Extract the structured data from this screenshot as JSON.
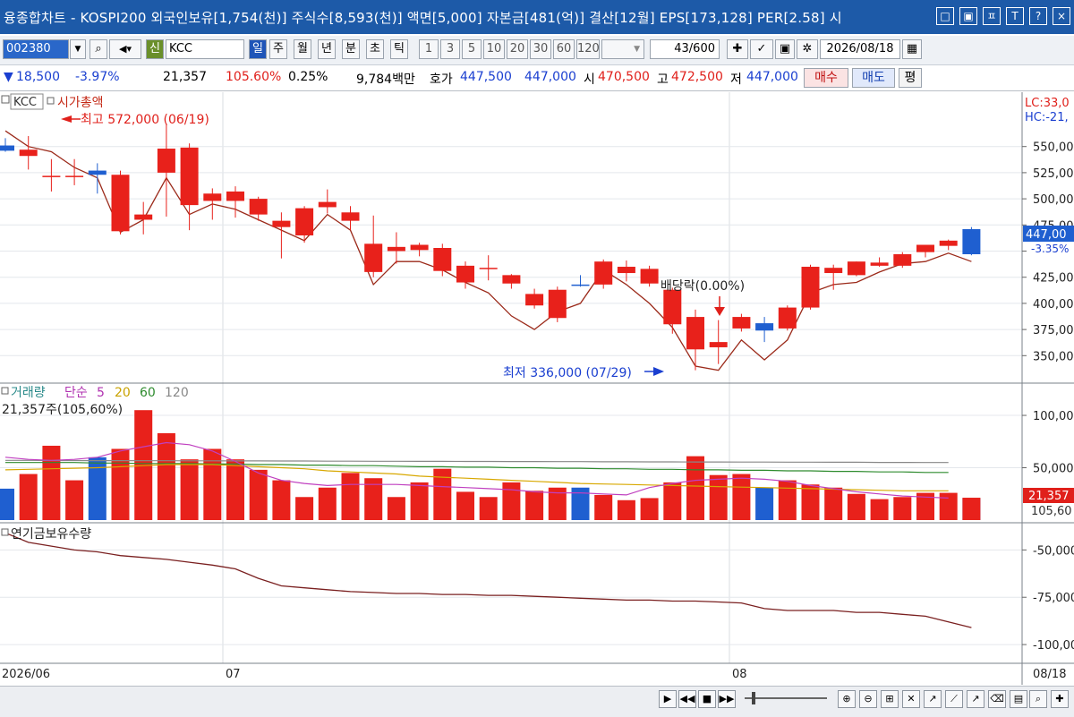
{
  "title": "융종합차트 - KOSPI200 외국인보유[1,754(천)] 주식수[8,593(천)] 액면[5,000] 자본금[481(억)] 결산[12월] EPS[173,128] PER[2.58] 시",
  "window_buttons": [
    "□",
    "▣",
    "ㅍ",
    "T",
    "?",
    "×"
  ],
  "toolbar": {
    "code": "002380",
    "new_label": "신",
    "name": "KCC",
    "periods": [
      "일",
      "주",
      "월",
      "년",
      "분",
      "초",
      "틱"
    ],
    "selected_period": "일",
    "minute_units": [
      "1",
      "3",
      "5",
      "10",
      "20",
      "30",
      "60",
      "120"
    ],
    "count": "43/600",
    "date": "2026/08/18"
  },
  "quote": {
    "change": "18,500",
    "change_pct": "-3.97%",
    "volume": "21,357",
    "volume_ratio": "105.60%",
    "turnover": "0.25%",
    "amount": "9,784백만",
    "bid_label": "호가",
    "ask": "447,500",
    "bid": "447,000",
    "open_label": "시",
    "open": "470,500",
    "high_label": "고",
    "high": "472,500",
    "low_label": "저",
    "low": "447,000",
    "buy": "매수",
    "sell": "매도",
    "eval": "평"
  },
  "colors": {
    "up": "#e8211b",
    "down": "#1f5fd0",
    "price_line": "#9b2a1a",
    "ma5": "#c040c0",
    "ma20": "#d8a800",
    "ma60": "#2e8b2e",
    "ma120": "#888888",
    "foreign_line": "#7a2020",
    "title_bg": "#1d5aa8"
  },
  "chart_data": [
    {
      "type": "candlestick",
      "legend_ticker": "KCC",
      "legend_series": "시가총액",
      "x_period_labels": [
        "2026/06",
        "07",
        "08",
        "08/18"
      ],
      "y_ticks": [
        350000,
        375000,
        400000,
        425000,
        450000,
        475000,
        500000,
        525000,
        550000
      ],
      "y_tick_labels": [
        "350,00",
        "375,00",
        "400,00",
        "425,00",
        "",
        "475,00",
        "500,00",
        "525,00",
        "550,00"
      ],
      "ylim": [
        328000,
        578000
      ],
      "ohlc": [
        [
          551000,
          558000,
          545000,
          546000
        ],
        [
          541000,
          560000,
          528000,
          547000
        ],
        [
          522000,
          538000,
          507000,
          522000
        ],
        [
          521000,
          538000,
          513000,
          522000
        ],
        [
          527000,
          534000,
          505000,
          523000
        ],
        [
          469000,
          527000,
          466000,
          523000
        ],
        [
          480000,
          497000,
          466000,
          485000
        ],
        [
          525000,
          572000,
          483000,
          548000
        ],
        [
          494000,
          553000,
          470000,
          549000
        ],
        [
          498000,
          510000,
          480000,
          505000
        ],
        [
          498000,
          512000,
          482000,
          507000
        ],
        [
          485000,
          502000,
          479000,
          500000
        ],
        [
          473000,
          487000,
          443000,
          479000
        ],
        [
          465000,
          493000,
          458000,
          491000
        ],
        [
          492000,
          509000,
          486000,
          497000
        ],
        [
          479000,
          493000,
          470000,
          487000
        ],
        [
          430000,
          484000,
          425000,
          457000
        ],
        [
          450000,
          468000,
          438000,
          454000
        ],
        [
          451000,
          458000,
          445000,
          456000
        ],
        [
          431000,
          457000,
          426000,
          453000
        ],
        [
          420000,
          440000,
          414000,
          436000
        ],
        [
          434000,
          446000,
          422000,
          434000
        ],
        [
          419000,
          428000,
          414000,
          427000
        ],
        [
          398000,
          414000,
          395000,
          409000
        ],
        [
          386000,
          416000,
          382000,
          413000
        ],
        [
          418000,
          427000,
          416000,
          417000
        ],
        [
          418000,
          442000,
          414000,
          440000
        ],
        [
          429000,
          441000,
          421000,
          435000
        ],
        [
          419000,
          436000,
          416000,
          433000
        ],
        [
          380000,
          415000,
          371000,
          413000
        ],
        [
          356000,
          394000,
          336000,
          387000
        ],
        [
          358000,
          384000,
          342000,
          363000
        ],
        [
          376000,
          390000,
          373000,
          387000
        ],
        [
          381000,
          387000,
          363000,
          374000
        ],
        [
          376000,
          398000,
          374000,
          396000
        ],
        [
          396000,
          437000,
          394000,
          435000
        ],
        [
          429000,
          437000,
          413000,
          434000
        ],
        [
          427000,
          440000,
          426000,
          440000
        ],
        [
          436000,
          444000,
          435000,
          439000
        ],
        [
          436000,
          449000,
          434000,
          447000
        ],
        [
          449000,
          456000,
          444000,
          456000
        ],
        [
          455000,
          461000,
          451000,
          460000
        ],
        [
          471000,
          473000,
          446000,
          447000
        ]
      ],
      "series": [
        {
          "name": "시가총액",
          "values": [
            565000,
            550000,
            545000,
            530000,
            520000,
            468000,
            480000,
            520000,
            485000,
            495000,
            490000,
            480000,
            470000,
            460000,
            485000,
            470000,
            418000,
            440000,
            440000,
            432000,
            420000,
            410000,
            388000,
            375000,
            392000,
            400000,
            432000,
            418000,
            400000,
            377000,
            340000,
            336000,
            365000,
            346000,
            365000,
            410000,
            418000,
            420000,
            430000,
            438000,
            440000,
            448000,
            440000
          ]
        }
      ],
      "annotations": [
        {
          "text": "최고 572,000 (06/19)",
          "value": 572000,
          "index": 7
        },
        {
          "text": "최저 336,000 (07/29)",
          "value": 336000,
          "index": 30
        },
        {
          "text": "배당락(0.00%)",
          "index": 31
        }
      ],
      "right_labels": {
        "lc": "LC:33,0",
        "hc": "HC:-21,",
        "current": "447,00",
        "current_pct": "-3.35%"
      }
    },
    {
      "type": "bar",
      "title": "거래량",
      "ma_label": "단순",
      "ma_periods": [
        "5",
        "20",
        "60",
        "120"
      ],
      "info": "21,357주(105,60%)",
      "y_ticks": [
        50000,
        100000
      ],
      "y_tick_labels": [
        "50,000",
        "100,000"
      ],
      "ylim": [
        0,
        118000
      ],
      "values": [
        30000,
        44000,
        71000,
        38000,
        60000,
        68000,
        105000,
        83000,
        58000,
        68000,
        58000,
        48000,
        38000,
        22000,
        31000,
        45000,
        40000,
        22000,
        36000,
        49000,
        27000,
        22000,
        36000,
        28000,
        31000,
        31000,
        24000,
        19000,
        21000,
        36000,
        61000,
        43000,
        44000,
        31000,
        38000,
        34000,
        31000,
        25000,
        20000,
        22000,
        26000,
        26000,
        21000,
        21357
      ],
      "ma5": [
        60000,
        58000,
        57000,
        58000,
        60000,
        66000,
        70000,
        74000,
        72000,
        66000,
        56000,
        45000,
        38000,
        35000,
        33000,
        34000,
        34000,
        34000,
        33000,
        32000,
        31000,
        30000,
        29000,
        27000,
        26000,
        26000,
        25000,
        24000,
        31000,
        35000,
        38000,
        39000,
        40000,
        39000,
        37000,
        33000,
        30000,
        27000,
        25000,
        23000,
        22000,
        21000
      ],
      "ma20": [
        48000,
        48500,
        49000,
        49500,
        50000,
        51000,
        52000,
        53000,
        53000,
        53000,
        52000,
        51000,
        50000,
        49000,
        47000,
        46000,
        45000,
        44000,
        42000,
        41000,
        40000,
        39000,
        38000,
        37000,
        36000,
        35000,
        34500,
        34000,
        33500,
        33000,
        32500,
        32000,
        31500,
        31000,
        30500,
        30000,
        29500,
        29000,
        28500,
        28000,
        28000,
        28000
      ],
      "ma60": [
        55000,
        55000,
        55000,
        55000,
        54500,
        54500,
        54000,
        54000,
        54000,
        53500,
        53500,
        53000,
        53000,
        52500,
        52500,
        52000,
        52000,
        51500,
        51000,
        51000,
        50500,
        50500,
        50000,
        50000,
        49500,
        49500,
        49000,
        49000,
        48500,
        48500,
        48000,
        48000,
        47500,
        47500,
        47000,
        47000,
        46500,
        46500,
        46000,
        46000,
        45500,
        45500
      ],
      "ma120": [
        57000,
        57000,
        56900,
        56900,
        56800,
        56800,
        56700,
        56700,
        56600,
        56600,
        56500,
        56500,
        56400,
        56400,
        56300,
        56300,
        56200,
        56200,
        56100,
        56100,
        56000,
        56000,
        55900,
        55900,
        55800,
        55800,
        55700,
        55700,
        55600,
        55600,
        55500,
        55500,
        55400,
        55400,
        55300,
        55300,
        55200,
        55200,
        55100,
        55100,
        55000,
        55000
      ],
      "right_labels": {
        "current": "21,357",
        "pct": "105,60"
      }
    },
    {
      "type": "line",
      "title": "연기금보유수량",
      "y_ticks": [
        -50000,
        -75000,
        -100000
      ],
      "y_tick_labels": [
        "-50,000",
        "-75,000",
        "-100,000"
      ],
      "ylim": [
        -108000,
        -38000
      ],
      "values": [
        -41000,
        -46000,
        -48000,
        -50000,
        -51000,
        -53000,
        -54000,
        -55000,
        -56500,
        -58000,
        -60000,
        -65000,
        -69000,
        -70000,
        -71000,
        -72000,
        -72500,
        -73000,
        -73000,
        -73500,
        -73500,
        -74000,
        -74000,
        -74500,
        -75000,
        -75500,
        -76000,
        -76500,
        -76500,
        -77000,
        -77000,
        -77500,
        -78000,
        -81000,
        -82000,
        -82000,
        -82000,
        -83000,
        -83000,
        -84000,
        -85000,
        -88000,
        -91000
      ]
    }
  ]
}
